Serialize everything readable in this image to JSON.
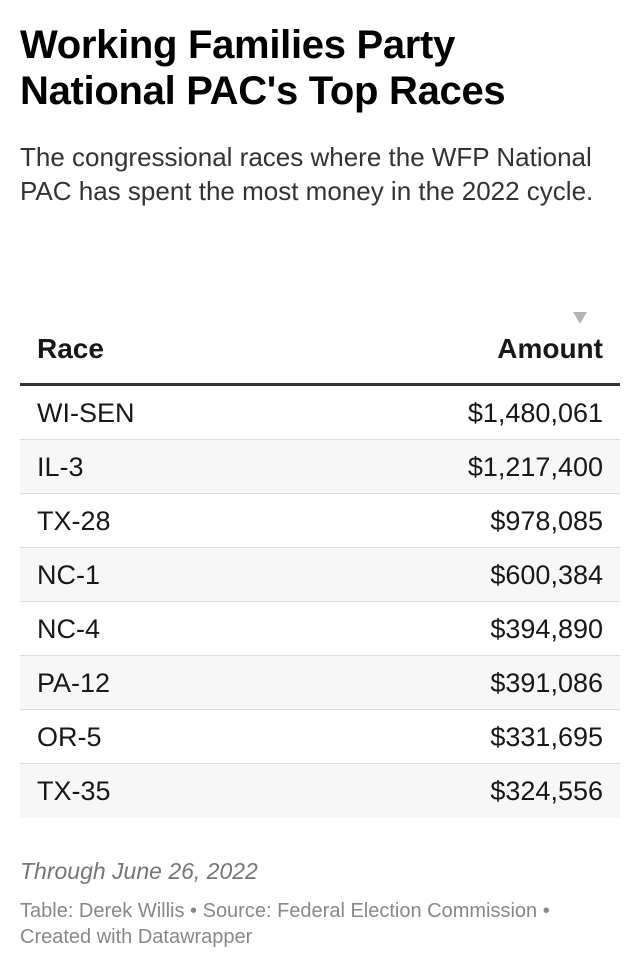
{
  "title": "Working Families Party National PAC's Top Races",
  "subtitle": "The congressional races where the WFP National PAC has spent the most money in the 2022 cycle.",
  "columns": {
    "race": "Race",
    "amount": "Amount"
  },
  "sort": {
    "column": "Amount",
    "direction": "descending",
    "icon": "sort-down-triangle"
  },
  "chart_data": {
    "type": "table",
    "columns": [
      "Race",
      "Amount"
    ],
    "rows": [
      {
        "race": "WI-SEN",
        "amount": "$1,480,061"
      },
      {
        "race": "IL-3",
        "amount": "$1,217,400"
      },
      {
        "race": "TX-28",
        "amount": "$978,085"
      },
      {
        "race": "NC-1",
        "amount": "$600,384"
      },
      {
        "race": "NC-4",
        "amount": "$394,890"
      },
      {
        "race": "PA-12",
        "amount": "$391,086"
      },
      {
        "race": "OR-5",
        "amount": "$331,695"
      },
      {
        "race": "TX-35",
        "amount": "$324,556"
      }
    ]
  },
  "notes": "Through June 26, 2022",
  "footer": {
    "line1": "Table: Derek Willis • Source: Federal Election Commission •",
    "line2": "Created with Datawrapper"
  },
  "colors": {
    "header_rule": "#333333",
    "row_stripe": "#f7f7f7",
    "row_divider": "#dddddd",
    "muted_text": "#888888"
  }
}
